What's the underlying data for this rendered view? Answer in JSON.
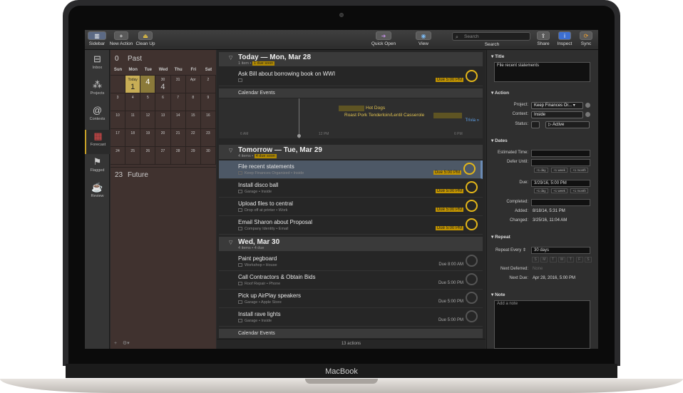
{
  "device": {
    "brand": "MacBook"
  },
  "toolbar": {
    "sidebar": "Sidebar",
    "new_action": "New Action",
    "clean_up": "Clean Up",
    "quick_open": "Quick Open",
    "view": "View",
    "search": "Search",
    "search_placeholder": "Search",
    "share": "Share",
    "inspect": "Inspect",
    "sync": "Sync"
  },
  "rail": [
    "Inbox",
    "Projects",
    "Contexts",
    "Forecast",
    "Flagged",
    "Review"
  ],
  "calendar": {
    "past_count": "0",
    "past_label": "Past",
    "daynames": [
      "Sun",
      "Mon",
      "Tue",
      "Wed",
      "Thu",
      "Fri",
      "Sat"
    ],
    "cells": [
      {
        "small": "",
        "big": ""
      },
      {
        "small": "Today",
        "big": "1"
      },
      {
        "small": "",
        "big": "4"
      },
      {
        "small": "30",
        "big": "4"
      },
      {
        "small": "31",
        "big": ""
      },
      {
        "small": "Apr",
        "big": ""
      },
      {
        "small": "2",
        "big": ""
      },
      {
        "small": "3",
        "big": ""
      },
      {
        "small": "4",
        "big": ""
      },
      {
        "small": "5",
        "big": ""
      },
      {
        "small": "6",
        "big": ""
      },
      {
        "small": "7",
        "big": ""
      },
      {
        "small": "8",
        "big": ""
      },
      {
        "small": "9",
        "big": ""
      },
      {
        "small": "10",
        "big": ""
      },
      {
        "small": "11",
        "big": ""
      },
      {
        "small": "12",
        "big": ""
      },
      {
        "small": "13",
        "big": ""
      },
      {
        "small": "14",
        "big": ""
      },
      {
        "small": "15",
        "big": ""
      },
      {
        "small": "16",
        "big": ""
      },
      {
        "small": "17",
        "big": ""
      },
      {
        "small": "18",
        "big": ""
      },
      {
        "small": "19",
        "big": ""
      },
      {
        "small": "20",
        "big": ""
      },
      {
        "small": "21",
        "big": ""
      },
      {
        "small": "22",
        "big": ""
      },
      {
        "small": "23",
        "big": ""
      },
      {
        "small": "24",
        "big": ""
      },
      {
        "small": "25",
        "big": ""
      },
      {
        "small": "26",
        "big": ""
      },
      {
        "small": "27",
        "big": ""
      },
      {
        "small": "28",
        "big": ""
      },
      {
        "small": "29",
        "big": ""
      },
      {
        "small": "30",
        "big": ""
      }
    ],
    "future_count": "23",
    "future_label": "Future"
  },
  "outline": {
    "today": {
      "title": "Today — Mon, Mar 28",
      "sub": "1 item •",
      "badge": "1 due soon"
    },
    "today_rows": [
      {
        "name": "Ask Bill about borrowing book on WWI",
        "meta": "",
        "due": "Due 5:00 PM"
      }
    ],
    "cal_events_label": "Calendar Events",
    "events": [
      "Hot Dogs",
      "Roast Pork Tenderloin/Lentil Casserole"
    ],
    "ticks": [
      "6 AM",
      "12 PM",
      "6 PM"
    ],
    "trivia": "Trivia »",
    "tomorrow": {
      "title": "Tomorrow — Tue, Mar 29",
      "sub": "4 items •",
      "badge": "4 due soon"
    },
    "tomorrow_rows": [
      {
        "name": "File recent statements",
        "meta": "Keep Finances Organized • Inside",
        "due": "Due 5:00 PM"
      },
      {
        "name": "Install disco ball",
        "meta": "Garage • Inside",
        "due": "Due 5:00 PM"
      },
      {
        "name": "Upload files to central",
        "meta": "Drop off at printer • Work",
        "due": "Due 5:00 PM"
      },
      {
        "name": "Email Sharon about Proposal",
        "meta": "Company Identity • Email",
        "due": "Due 5:00 PM"
      }
    ],
    "wed": {
      "title": "Wed, Mar 30",
      "sub": "4 items • 4 due"
    },
    "wed_rows": [
      {
        "name": "Paint pegboard",
        "meta": "Workshop • House",
        "due": "Due 8:00 AM"
      },
      {
        "name": "Call Contractors & Obtain Bids",
        "meta": "Roof Repair • Phone",
        "due": "Due 5:00 PM"
      },
      {
        "name": "Pick up AirPlay speakers",
        "meta": "Garage • Apple Store",
        "due": "Due 5:00 PM"
      },
      {
        "name": "Install rave lights",
        "meta": "Garage • Inside",
        "due": "Due 5:00 PM"
      }
    ],
    "cal_events_label2": "Calendar Events",
    "footer": "13 actions"
  },
  "inspector": {
    "title_section": "Title",
    "title_value": "File recent statements",
    "action_section": "Action",
    "project_label": "Project:",
    "project_value": "Keep Finances Or...",
    "context_label": "Context:",
    "context_value": "Inside",
    "status_label": "Status:",
    "status_value": "Active",
    "dates_section": "Dates",
    "estimated_label": "Estimated Time:",
    "defer_label": "Defer Until:",
    "due_label": "Due:",
    "due_value": "3/29/16, 5:00 PM",
    "completed_label": "Completed:",
    "added_label": "Added:",
    "added_value": "8/18/14, 5:31 PM",
    "changed_label": "Changed:",
    "changed_value": "3/25/16, 11:04 AM",
    "plus_day": "+1 day",
    "plus_week": "+1 week",
    "plus_month": "+1 month",
    "repeat_section": "Repeat",
    "repeat_every_label": "Repeat Every",
    "repeat_every_value": "30 days",
    "weekdays": [
      "S",
      "M",
      "T",
      "W",
      "T",
      "F",
      "S"
    ],
    "next_deferred_label": "Next Deferred:",
    "next_deferred_value": "None",
    "next_due_label": "Next Due:",
    "next_due_value": "Apr 28, 2016, 5:00 PM",
    "note_section": "Note",
    "note_placeholder": "Add a note"
  }
}
